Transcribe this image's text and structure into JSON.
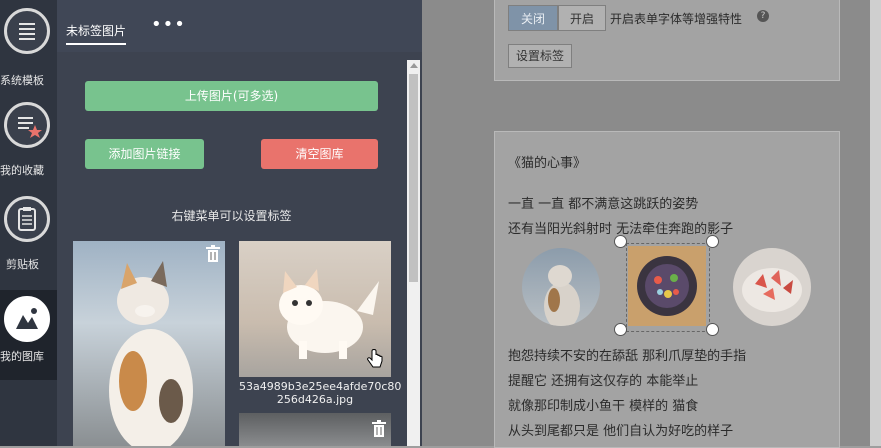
{
  "nav": {
    "items": [
      {
        "label": "系统模板",
        "icon": "template-list-icon"
      },
      {
        "label": "我的收藏",
        "icon": "favorites-star-icon"
      },
      {
        "label": "剪贴板",
        "icon": "clipboard-icon"
      },
      {
        "label": "我的图库",
        "icon": "gallery-icon"
      }
    ]
  },
  "panel": {
    "tab_label": "未标签图片",
    "more_label": "•••",
    "upload_label": "上传图片(可多选)",
    "add_link_label": "添加图片链接",
    "clear_label": "清空图库",
    "hint": "右键菜单可以设置标签",
    "image_caption_line1": "53a4989b3e25ee4afde70c80",
    "image_caption_line2": "256d426a.jpg"
  },
  "editor": {
    "toggle_off": "关闭",
    "toggle_on": "开启",
    "toggle_desc": "开启表单字体等增强特性",
    "set_tag_label": "设置标签",
    "poem_title": "《猫的心事》",
    "lines_top": [
      "一直 一直 都不满意这跳跃的姿势",
      "还有当阳光斜射时 无法牵住奔跑的影子"
    ],
    "lines_bottom": [
      "抱怨持续不安的在舔舐 那利爪厚垫的手指",
      "提醒它 还拥有这仅存的 本能举止",
      "就像那印制成小鱼干 模样的 猫食",
      "从头到尾都只是 他们自认为好吃的样子"
    ]
  },
  "colors": {
    "nav_bg": "#2f3540",
    "panel_bg": "#3d4350",
    "green": "#78c38e",
    "red": "#e9736c"
  }
}
